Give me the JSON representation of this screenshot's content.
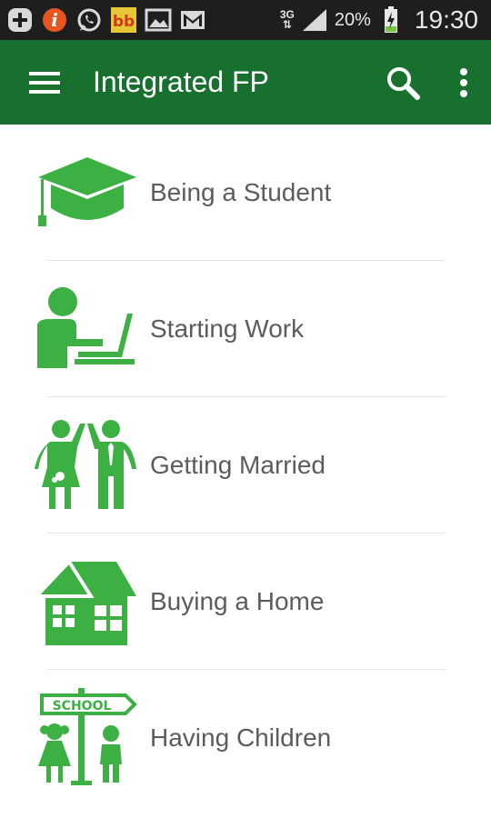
{
  "status_bar": {
    "network": "3G",
    "battery": "20%",
    "time": "19:30",
    "notification_icons": [
      "add-icon",
      "info-icon",
      "whatsapp-icon",
      "bb-app-icon",
      "gallery-icon",
      "gmail-icon"
    ]
  },
  "app_bar": {
    "title": "Integrated FP",
    "color": "#17702e"
  },
  "accent_color": "#3cb043",
  "items": [
    {
      "label": "Being a Student",
      "icon": "graduation-cap-icon"
    },
    {
      "label": "Starting Work",
      "icon": "person-laptop-icon"
    },
    {
      "label": "Getting Married",
      "icon": "couple-icon"
    },
    {
      "label": "Buying a Home",
      "icon": "house-icon"
    },
    {
      "label": "Having Children",
      "icon": "school-children-icon"
    }
  ]
}
